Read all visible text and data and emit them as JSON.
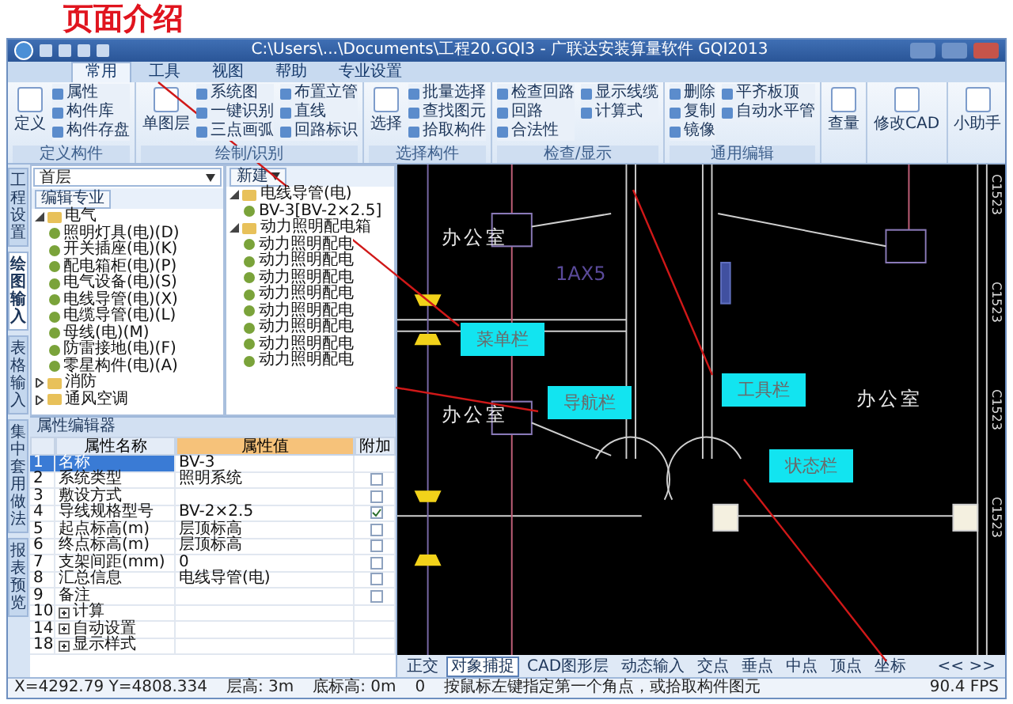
{
  "slide_title": "页面介绍",
  "window": {
    "title": "C:\\Users\\...\\Documents\\工程20.GQI3 - 广联达安装算量软件 GQI2013"
  },
  "menu_tabs": [
    {
      "label": "常用",
      "selected": true
    },
    {
      "label": "工具",
      "selected": false
    },
    {
      "label": "视图",
      "selected": false
    },
    {
      "label": "帮助",
      "selected": false
    },
    {
      "label": "专业设置",
      "selected": false
    }
  ],
  "ribbon_groups": [
    {
      "label": "定义构件",
      "large": "定义",
      "items": [
        "属性",
        "构件库",
        "构件存盘"
      ]
    },
    {
      "label": "绘制/识别",
      "large": "单图层",
      "items": [
        "系统图",
        "一键识别",
        "三点画弧",
        "布置立管",
        "直线",
        "回路标识"
      ]
    },
    {
      "label": "选择构件",
      "large": "选择",
      "items": [
        "批量选择",
        "查找图元",
        "拾取构件"
      ]
    },
    {
      "label": "检查/显示",
      "items": [
        "检查回路",
        "回路",
        "合法性",
        "显示线缆",
        "计算式"
      ]
    },
    {
      "label": "通用编辑",
      "items": [
        "删除",
        "复制",
        "镜像",
        "平齐板顶",
        "自动水平管"
      ]
    }
  ],
  "ribbon_buttons": [
    "查量",
    "修改CAD",
    "小助手"
  ],
  "side_tabs": [
    {
      "label": "工程设置",
      "selected": false
    },
    {
      "label": "绘图输入",
      "selected": true
    },
    {
      "label": "表格输入",
      "selected": false
    },
    {
      "label": "集中套用做法",
      "selected": false
    },
    {
      "label": "报表预览",
      "selected": false
    }
  ],
  "navigator": {
    "floor": "首层",
    "button": "编辑专业",
    "tree": [
      {
        "label": "电气",
        "expanded": true,
        "children": [
          {
            "label": "照明灯具(电)(D)"
          },
          {
            "label": "开关插座(电)(K)"
          },
          {
            "label": "配电箱柜(电)(P)"
          },
          {
            "label": "电气设备(电)(S)"
          },
          {
            "label": "电线导管(电)(X)"
          },
          {
            "label": "电缆导管(电)(L)"
          },
          {
            "label": "母线(电)(M)"
          },
          {
            "label": "防雷接地(电)(F)"
          },
          {
            "label": "零星构件(电)(A)"
          }
        ]
      },
      {
        "label": "消防",
        "expanded": false
      },
      {
        "label": "通风空调",
        "expanded": false
      }
    ]
  },
  "component_list": {
    "new_button": "新建",
    "tree": [
      {
        "label": "电线导管(电)",
        "expanded": true,
        "children": [
          {
            "label": "BV-3[BV-2×2.5]"
          }
        ]
      },
      {
        "label": "动力照明配电箱",
        "expanded": true,
        "children": [
          {
            "label": "动力照明配电"
          },
          {
            "label": "动力照明配电"
          },
          {
            "label": "动力照明配电"
          },
          {
            "label": "动力照明配电"
          },
          {
            "label": "动力照明配电"
          },
          {
            "label": "动力照明配电"
          },
          {
            "label": "动力照明配电"
          },
          {
            "label": "动力照明配电"
          }
        ]
      }
    ]
  },
  "properties": {
    "title": "属性编辑器",
    "columns": [
      "属性名称",
      "属性值",
      "附加"
    ],
    "rows": [
      {
        "index": "1",
        "kind": "plain",
        "name": "名称",
        "value": "BV-3",
        "selected": true
      },
      {
        "index": "2",
        "kind": "check",
        "name": "系统类型",
        "value": "照明系统",
        "checked": false,
        "selected": false
      },
      {
        "index": "3",
        "kind": "check",
        "name": "敷设方式",
        "checked": false,
        "selected": false
      },
      {
        "index": "4",
        "kind": "check",
        "name": "导线规格型号",
        "value": "BV-2×2.5",
        "checked": true,
        "selected": false
      },
      {
        "index": "5",
        "kind": "check",
        "name": "起点标高(m)",
        "value": "层顶标高",
        "checked": false,
        "selected": false
      },
      {
        "index": "6",
        "kind": "check",
        "name": "终点标高(m)",
        "value": "层顶标高",
        "checked": false,
        "selected": false
      },
      {
        "index": "7",
        "kind": "check",
        "name": "支架间距(mm)",
        "value": "0",
        "checked": false,
        "selected": false
      },
      {
        "index": "8",
        "kind": "check",
        "name": "汇总信息",
        "value": "电线导管(电)",
        "checked": false,
        "selected": false
      },
      {
        "index": "9",
        "kind": "check",
        "name": "备注",
        "checked": false,
        "selected": false
      },
      {
        "index": "10",
        "kind": "group",
        "name": "计算",
        "selected": false
      },
      {
        "index": "14",
        "kind": "group",
        "name": "自动设置",
        "selected": false
      },
      {
        "index": "18",
        "kind": "group",
        "name": "显示样式",
        "selected": false
      }
    ]
  },
  "canvas": {
    "rooms": [
      "办公室",
      "办公室",
      "办公室"
    ],
    "tag": "1AX5",
    "axis_labels": [
      "C1523",
      "C1523",
      "C1523",
      "C1523"
    ],
    "callouts": [
      {
        "label": "菜单栏"
      },
      {
        "label": "导航栏"
      },
      {
        "label": "工具栏"
      },
      {
        "label": "状态栏"
      }
    ]
  },
  "snap_bar": {
    "items": [
      {
        "label": "正交",
        "selected": false
      },
      {
        "label": "对象捕捉",
        "selected": true
      },
      {
        "label": "CAD图形层",
        "selected": false
      },
      {
        "label": "动态输入",
        "selected": false
      },
      {
        "label": "交点",
        "selected": false
      },
      {
        "label": "垂点",
        "selected": false
      },
      {
        "label": "中点",
        "selected": false
      },
      {
        "label": "顶点",
        "selected": false
      },
      {
        "label": "坐标",
        "selected": false
      }
    ],
    "nav": "<< >>"
  },
  "status_bar": {
    "coords": "X=4292.79 Y=4808.334",
    "floor_height": "层高: 3m",
    "bottom_elevation": "底标高: 0m",
    "value": "0",
    "hint": "按鼠标左键指定第一个角点，或拾取构件图元",
    "fps": "90.4 FPS"
  }
}
